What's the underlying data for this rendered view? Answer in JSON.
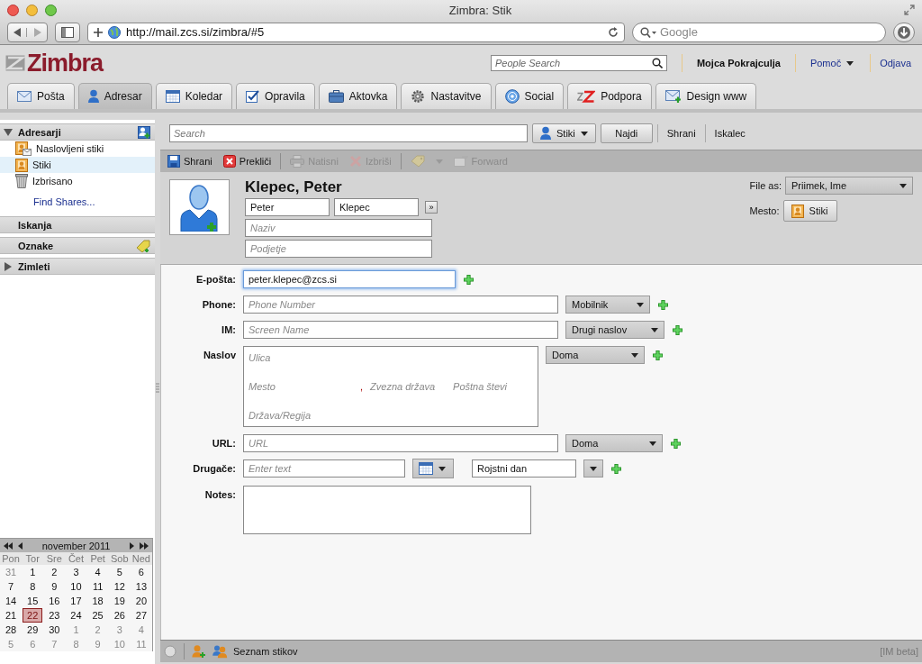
{
  "browser": {
    "title": "Zimbra: Stik",
    "url": "http://mail.zcs.si/zimbra/#5",
    "search_placeholder": "Google"
  },
  "header": {
    "logo": "Zimbra",
    "people_search_placeholder": "People Search",
    "user": "Mojca Pokrajculja",
    "help": "Pomoč",
    "logout": "Odjava"
  },
  "tabs": [
    {
      "label": "Pošta",
      "kind": "mail",
      "selected": false
    },
    {
      "label": "Adresar",
      "kind": "contact",
      "selected": true
    },
    {
      "label": "Koledar",
      "kind": "calendar",
      "selected": false
    },
    {
      "label": "Opravila",
      "kind": "task",
      "selected": false
    },
    {
      "label": "Aktovka",
      "kind": "briefcase",
      "selected": false
    },
    {
      "label": "Nastavitve",
      "kind": "gear",
      "selected": false
    },
    {
      "label": "Social",
      "kind": "social",
      "selected": false
    },
    {
      "label": "Podpora",
      "kind": "support",
      "selected": false
    },
    {
      "label": "Design www",
      "kind": "design",
      "selected": false
    }
  ],
  "sidebar": {
    "sections": [
      {
        "title": "Adresarji",
        "expanded": true,
        "add": true,
        "items": [
          {
            "label": "Naslovljeni stiki",
            "kind": "shared",
            "selected": false
          },
          {
            "label": "Stiki",
            "kind": "book",
            "selected": true
          },
          {
            "label": "Izbrisano",
            "kind": "trash",
            "selected": false
          }
        ],
        "link": "Find Shares..."
      },
      {
        "title": "Iskanja"
      },
      {
        "title": "Oznake",
        "tag": true
      },
      {
        "title": "Zimleti",
        "expanded": false
      }
    ]
  },
  "calendar": {
    "month": "november 2011",
    "weekdays": [
      "Pon",
      "Tor",
      "Sre",
      "Čet",
      "Pet",
      "Sob",
      "Ned"
    ],
    "weeks": [
      [
        {
          "day": "31",
          "other": true,
          "selected": false
        },
        {
          "day": "1",
          "other": false,
          "selected": false
        },
        {
          "day": "2",
          "other": false,
          "selected": false
        },
        {
          "day": "3",
          "other": false,
          "selected": false
        },
        {
          "day": "4",
          "other": false,
          "selected": false
        },
        {
          "day": "5",
          "other": false,
          "selected": false
        },
        {
          "day": "6",
          "other": false,
          "selected": false
        }
      ],
      [
        {
          "day": "7",
          "other": false,
          "selected": false
        },
        {
          "day": "8",
          "other": false,
          "selected": false
        },
        {
          "day": "9",
          "other": false,
          "selected": false
        },
        {
          "day": "10",
          "other": false,
          "selected": false
        },
        {
          "day": "11",
          "other": false,
          "selected": false
        },
        {
          "day": "12",
          "other": false,
          "selected": false
        },
        {
          "day": "13",
          "other": false,
          "selected": false
        }
      ],
      [
        {
          "day": "14",
          "other": false,
          "selected": false
        },
        {
          "day": "15",
          "other": false,
          "selected": false
        },
        {
          "day": "16",
          "other": false,
          "selected": false
        },
        {
          "day": "17",
          "other": false,
          "selected": false
        },
        {
          "day": "18",
          "other": false,
          "selected": false
        },
        {
          "day": "19",
          "other": false,
          "selected": false
        },
        {
          "day": "20",
          "other": false,
          "selected": false
        }
      ],
      [
        {
          "day": "21",
          "other": false,
          "selected": false
        },
        {
          "day": "22",
          "other": false,
          "selected": true
        },
        {
          "day": "23",
          "other": false,
          "selected": false
        },
        {
          "day": "24",
          "other": false,
          "selected": false
        },
        {
          "day": "25",
          "other": false,
          "selected": false
        },
        {
          "day": "26",
          "other": false,
          "selected": false
        },
        {
          "day": "27",
          "other": false,
          "selected": false
        }
      ],
      [
        {
          "day": "28",
          "other": false,
          "selected": false
        },
        {
          "day": "29",
          "other": false,
          "selected": false
        },
        {
          "day": "30",
          "other": false,
          "selected": false
        },
        {
          "day": "1",
          "other": true,
          "selected": false
        },
        {
          "day": "2",
          "other": true,
          "selected": false
        },
        {
          "day": "3",
          "other": true,
          "selected": false
        },
        {
          "day": "4",
          "other": true,
          "selected": false
        }
      ],
      [
        {
          "day": "5",
          "other": true,
          "selected": false
        },
        {
          "day": "6",
          "other": true,
          "selected": false
        },
        {
          "day": "7",
          "other": true,
          "selected": false
        },
        {
          "day": "8",
          "other": true,
          "selected": false
        },
        {
          "day": "9",
          "other": true,
          "selected": false
        },
        {
          "day": "10",
          "other": true,
          "selected": false
        },
        {
          "day": "11",
          "other": true,
          "selected": false
        }
      ]
    ]
  },
  "search": {
    "placeholder": "Search",
    "scope": "Stiki",
    "find": "Najdi",
    "save": "Shrani",
    "builder": "Iskalec"
  },
  "toolbar": [
    {
      "kind": "save",
      "label": "Shrani",
      "disabled": false
    },
    {
      "kind": "cancel",
      "label": "Prekliči",
      "disabled": false
    },
    {
      "kind": "print",
      "label": "Natisni",
      "disabled": true
    },
    {
      "kind": "delete",
      "label": "Izbriši",
      "disabled": true
    },
    {
      "kind": "tag",
      "disabled": true
    },
    {
      "kind": "forward",
      "label": "Forward",
      "disabled": true
    }
  ],
  "contact": {
    "name": "Klepec, Peter",
    "first": "Peter",
    "last": "Klepec",
    "more": "»",
    "title_placeholder": "Naziv",
    "company_placeholder": "Podjetje",
    "file_as_label": "File as:",
    "file_as": "Priimek, Ime",
    "folder_label": "Mesto:",
    "folder": "Stiki"
  },
  "fields": [
    {
      "kind": "text",
      "label": "E-pošta:",
      "value": "peter.klepec@zcs.si",
      "focused": true
    },
    {
      "kind": "text",
      "label": "Phone:",
      "placeholder": "Phone Number",
      "type": "Mobilnik",
      "focused": false
    },
    {
      "kind": "text",
      "label": "IM:",
      "placeholder": "Screen Name",
      "type": "Drugi naslov",
      "focused": false
    },
    {
      "kind": "address",
      "label": "Naslov",
      "street": "Ulica",
      "city": "Mesto",
      "separator": ",",
      "state": "Zvezna država",
      "zip": "Poštna števi",
      "country": "Država/Regija",
      "type": "Doma"
    },
    {
      "kind": "text",
      "label": "URL:",
      "placeholder": "URL",
      "type": "Doma",
      "focused": false
    },
    {
      "kind": "other",
      "label": "Drugače:",
      "placeholder": "Enter text",
      "type": "Rojstni dan"
    },
    {
      "kind": "notes",
      "label": "Notes:"
    }
  ],
  "status": {
    "label": "Seznam stikov",
    "badge": "[IM beta]"
  }
}
